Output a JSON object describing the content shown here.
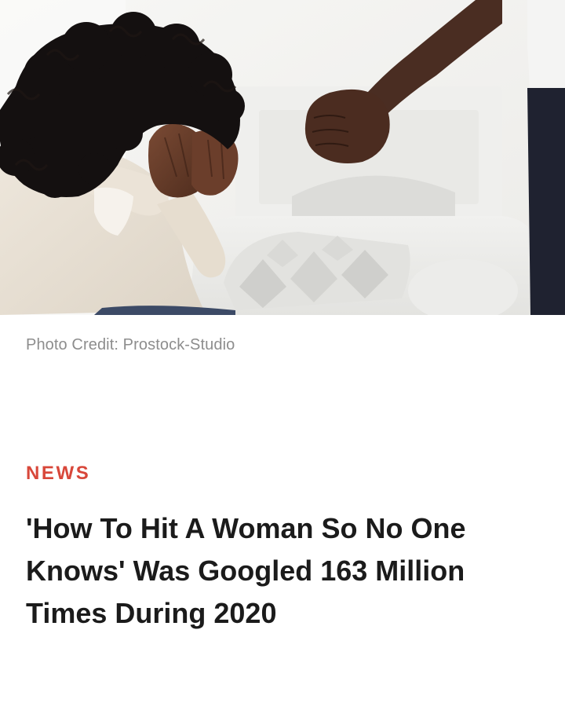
{
  "photo": {
    "subject": "woman-covering-face-and-raised-fist",
    "credit": "Photo Credit: Prostock-Studio"
  },
  "article": {
    "category": "NEWS",
    "headline": "'How To Hit A Woman So No One Knows' Was Googled 163 Million Times During 2020"
  },
  "colors": {
    "category": "#d8473a",
    "headline": "#1b1b1b",
    "credit": "#8d8d8d",
    "background": "#ffffff"
  }
}
